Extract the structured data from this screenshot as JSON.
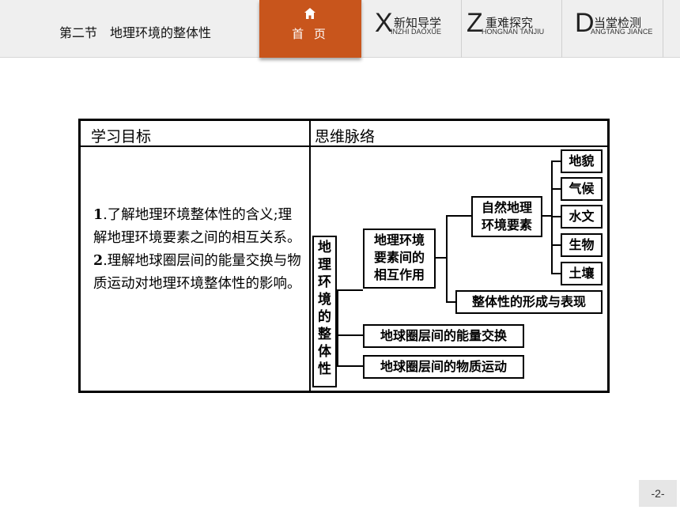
{
  "header": {
    "section_title": "第二节　地理环境的整体性",
    "home": {
      "icon": "home-icon",
      "label": "首 页"
    },
    "tabs": [
      {
        "letter": "X",
        "cn": "新知导学",
        "pinyin": "INZHI DAOXUE"
      },
      {
        "letter": "Z",
        "cn": "重难探究",
        "pinyin": "HONGNAN TANJIU"
      },
      {
        "letter": "D",
        "cn": "当堂检测",
        "pinyin": "ANGTANG JIANCE"
      }
    ]
  },
  "table": {
    "left_header": "学习目标",
    "right_header": "思维脉络",
    "objectives": [
      {
        "num": "1",
        "text": ".了解地理环境整体性的含义;理解地理环境要素之间的相互关系。"
      },
      {
        "num": "2",
        "text": ".理解地球圈层间的能量交换与物质运动对地理环境整体性的影响。"
      }
    ]
  },
  "mindmap": {
    "root": "地理环境的整体性",
    "interaction": [
      "地理环境",
      "要素间的",
      "相互作用"
    ],
    "natural_elements": [
      "自然地理",
      "环境要素"
    ],
    "elements": [
      "地貌",
      "气候",
      "水文",
      "生物",
      "土壤"
    ],
    "formation": "整体性的形成与表现",
    "energy_exchange": "地球圈层间的能量交换",
    "material_movement": "地球圈层间的物质运动"
  },
  "page_number": "-2-"
}
